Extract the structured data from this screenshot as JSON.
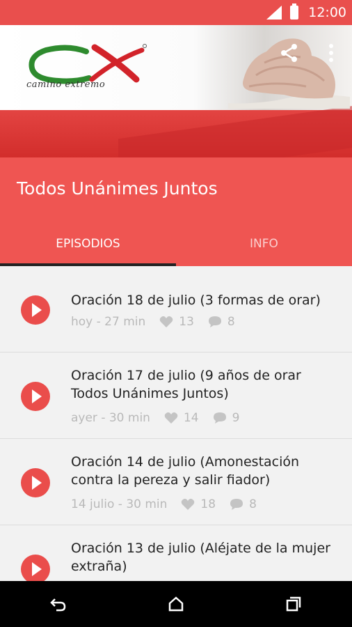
{
  "status": {
    "time": "12:00"
  },
  "header": {
    "logo_text": "camino extremo",
    "logo_letters": "CX"
  },
  "appbar": {
    "title": "Todos Unánimes Juntos",
    "tabs": [
      {
        "label": "EPISODIOS"
      },
      {
        "label": "INFO"
      }
    ]
  },
  "episodes": [
    {
      "title": "Oración 18 de julio (3 formas de orar)",
      "date": "hoy - 27 min",
      "likes": "13",
      "comments": "8"
    },
    {
      "title": "Oración 17 de julio (9 años de orar Todos Unánimes Juntos)",
      "date": "ayer - 30 min",
      "likes": "14",
      "comments": "9"
    },
    {
      "title": "Oración 14 de julio (Amonestación contra la pereza y salir fiador)",
      "date": "14 julio - 30 min",
      "likes": "18",
      "comments": "8"
    },
    {
      "title": "Oración 13 de julio (Aléjate de la mujer extraña)",
      "date": "",
      "likes": "",
      "comments": ""
    }
  ],
  "colors": {
    "accent": "#ef5552",
    "play": "#ea4d4b",
    "logo_green": "#2e8b2e",
    "logo_red": "#d2232a"
  }
}
